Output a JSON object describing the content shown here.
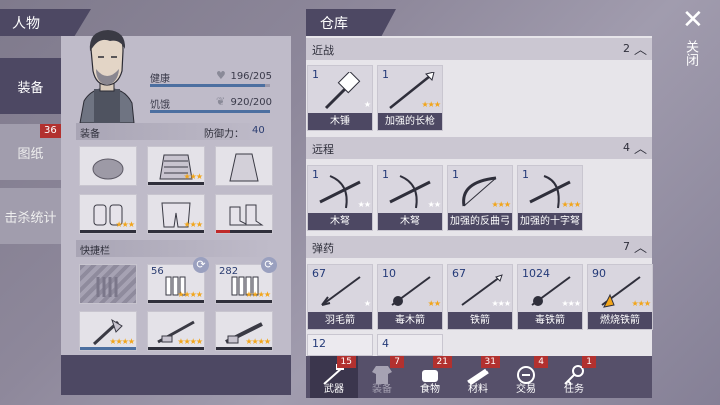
{
  "left": {
    "title": "人物",
    "tabs": [
      {
        "label": "装备"
      },
      {
        "label": "图纸",
        "badge": "36"
      },
      {
        "label": "击杀统计"
      }
    ],
    "stats": {
      "health_label": "健康",
      "health_value": "196/205",
      "health_fill": 0.96,
      "hunger_label": "饥饿",
      "hunger_value": "920/200",
      "hunger_fill": 1.0
    },
    "equipment_label": "装备",
    "defense_label": "防御力：",
    "defense_value": "40",
    "quickbar_label": "快捷栏",
    "quick_counts": [
      "56",
      "282"
    ]
  },
  "warehouse": {
    "title": "仓库",
    "categories": [
      {
        "label": "近战",
        "count": "2",
        "items": [
          {
            "count": "1",
            "name": "木锤",
            "stars": "★"
          },
          {
            "count": "1",
            "name": "加强的长枪",
            "stars": "★★★"
          }
        ]
      },
      {
        "label": "远程",
        "count": "4",
        "items": [
          {
            "count": "1",
            "name": "木弩",
            "stars": "★★"
          },
          {
            "count": "1",
            "name": "木弩",
            "stars": "★★"
          },
          {
            "count": "1",
            "name": "加强的反曲弓",
            "stars": "★★★"
          },
          {
            "count": "1",
            "name": "加强的十字弩",
            "stars": "★★★"
          }
        ]
      },
      {
        "label": "弹药",
        "count": "7",
        "items": [
          {
            "count": "67",
            "name": "羽毛箭",
            "stars": "★"
          },
          {
            "count": "10",
            "name": "毒木箭",
            "stars": "★★"
          },
          {
            "count": "67",
            "name": "铁箭",
            "stars": "★★★"
          },
          {
            "count": "1024",
            "name": "毒铁箭",
            "stars": "★★★"
          },
          {
            "count": "90",
            "name": "燃烧铁箭",
            "stars": "★★★"
          },
          {
            "count": "12",
            "name": "",
            "stars": ""
          },
          {
            "count": "4",
            "name": "",
            "stars": ""
          }
        ]
      }
    ],
    "bottom_tabs": [
      {
        "label": "武器",
        "badge": "15"
      },
      {
        "label": "装备",
        "badge": "7"
      },
      {
        "label": "食物",
        "badge": "21"
      },
      {
        "label": "材料",
        "badge": "31"
      },
      {
        "label": "交易",
        "badge": "4"
      },
      {
        "label": "任务",
        "badge": "1"
      }
    ]
  },
  "close_label": "关闭",
  "icons": [
    "heart-icon",
    "stomach-icon",
    "close-icon",
    "chevron-up-icon",
    "refresh-icon"
  ],
  "colors": {
    "panel_dark": "#4d4863",
    "star": "#f2a51a",
    "badge": "#b2312f",
    "bar": "#4c6fa0"
  }
}
